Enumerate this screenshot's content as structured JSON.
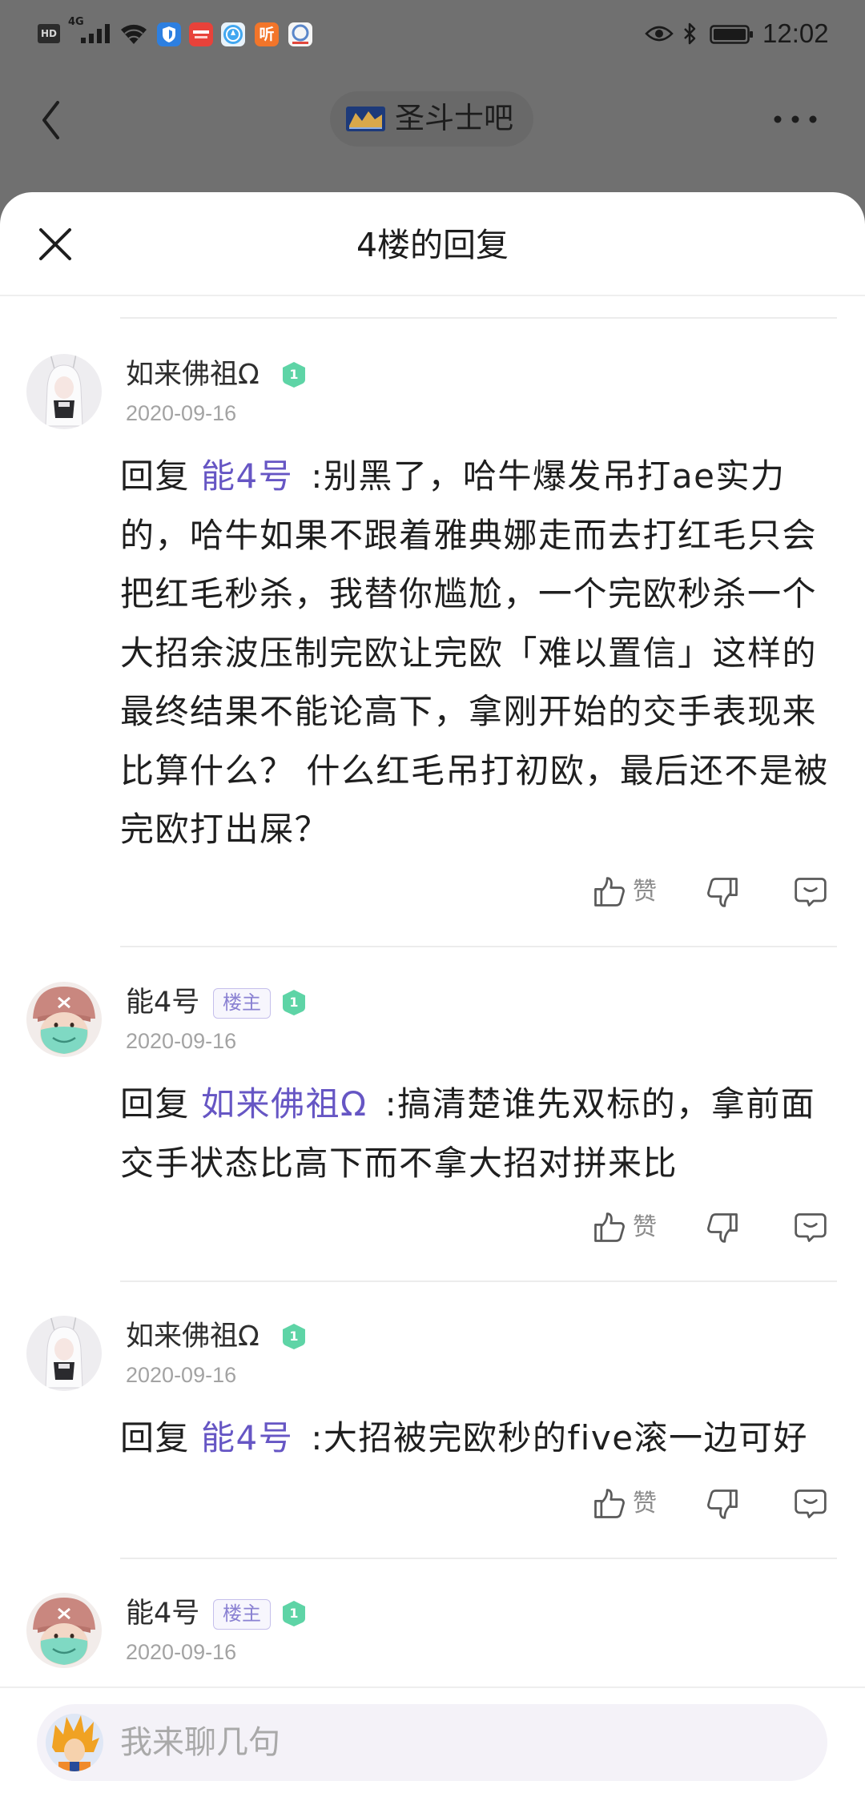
{
  "status_bar": {
    "hd_label": "HD",
    "network_label": "4G",
    "listen_app_glyph": "听",
    "time": "12:02",
    "icons": [
      "signal-icon",
      "wifi-icon",
      "shield-app-icon",
      "red-app-icon",
      "compass-app-icon",
      "listen-app-icon",
      "circle-app-icon",
      "eye-icon",
      "bluetooth-icon",
      "battery-icon"
    ]
  },
  "header": {
    "title": "圣斗士吧",
    "back_icon": "chevron-left-icon",
    "logo_icon": "forum-logo-icon",
    "more_icon": "more-dots-icon"
  },
  "sheet": {
    "title": "4楼的回复",
    "close_icon": "close-icon"
  },
  "op_badge_label": "楼主",
  "comments": [
    {
      "author": "如来佛祖Ω",
      "level": "1",
      "is_op": false,
      "date": "2020-09-16",
      "reply_prefix": "回复",
      "reply_to": "能4号",
      "lines": [
        ":别黑了，哈牛爆发吊打ae实力",
        "的，哈牛如果不跟着雅典娜走而去打红毛只会",
        "把红毛秒杀，我替你尴尬，一个完欧秒杀一个",
        "大招余波压制完欧让完欧「难以置信」这样的",
        "最终结果不能论高下，拿刚开始的交手表现来",
        "比算什么？ 什么红毛吊打初欧，最后还不是被",
        "完欧打出屎？"
      ],
      "like_label": "赞"
    },
    {
      "author": "能4号",
      "level": "1",
      "is_op": true,
      "date": "2020-09-16",
      "reply_prefix": "回复",
      "reply_to": "如来佛祖Ω",
      "lines": [
        ":搞清楚谁先双标的，拿前面",
        "交手状态比高下而不拿大招对拼来比"
      ],
      "like_label": "赞"
    },
    {
      "author": "如来佛祖Ω",
      "level": "1",
      "is_op": false,
      "date": "2020-09-16",
      "reply_prefix": "回复",
      "reply_to": "能4号",
      "lines": [
        ":大招被完欧秒的five滚一边可好"
      ],
      "like_label": "赞"
    },
    {
      "author": "能4号",
      "level": "1",
      "is_op": true,
      "date": "2020-09-16"
    }
  ],
  "action_icons": [
    "thumbs-up-icon",
    "thumbs-down-icon",
    "reply-bubble-icon"
  ],
  "input": {
    "placeholder": "我来聊几句"
  },
  "colors": {
    "overlay": "#707070",
    "sheet_bg": "#ffffff",
    "text": "#1f1f1f",
    "link": "#6656c4",
    "muted": "#a3a3a3",
    "level_badge": "#5ed4a6",
    "op_badge": "#8a81d2",
    "divider": "#ececec",
    "input_bg": "#f4f2f8"
  }
}
